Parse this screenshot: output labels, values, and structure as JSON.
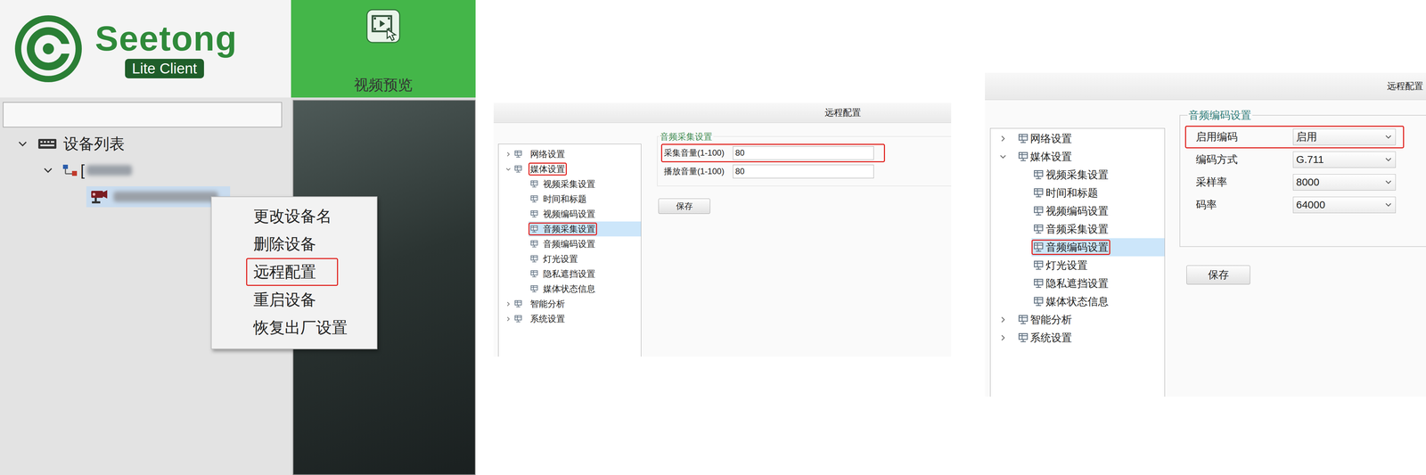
{
  "client": {
    "logo": {
      "name": "Seetong",
      "badge": "Lite Client"
    },
    "nav_tabs": [
      {
        "label": "视频预览",
        "selected": true
      }
    ],
    "device_tree": {
      "label": "设备列表",
      "expanded": true,
      "groups": [
        {
          "label": "[",
          "expanded": true,
          "devices": [
            {
              "selected": true
            }
          ]
        }
      ]
    },
    "context_menu": [
      {
        "label": "更改设备名",
        "highlighted": false
      },
      {
        "label": "删除设备",
        "highlighted": false
      },
      {
        "label": "远程配置",
        "highlighted": true
      },
      {
        "label": "重启设备",
        "highlighted": false
      },
      {
        "label": "恢复出厂设置",
        "highlighted": false
      }
    ]
  },
  "windows": [
    {
      "title": "远程配置",
      "tree": [
        {
          "label": "网络设置",
          "expanded": false,
          "highlighted": false,
          "selected": false,
          "children": []
        },
        {
          "label": "媒体设置",
          "expanded": true,
          "highlighted": true,
          "selected": false,
          "children": [
            {
              "label": "视频采集设置",
              "highlighted": false,
              "selected": false
            },
            {
              "label": "时间和标题",
              "highlighted": false,
              "selected": false
            },
            {
              "label": "视频编码设置",
              "highlighted": false,
              "selected": false
            },
            {
              "label": "音频采集设置",
              "highlighted": true,
              "selected": true
            },
            {
              "label": "音频编码设置",
              "highlighted": false,
              "selected": false
            },
            {
              "label": "灯光设置",
              "highlighted": false,
              "selected": false
            },
            {
              "label": "隐私遮挡设置",
              "highlighted": false,
              "selected": false
            },
            {
              "label": "媒体状态信息",
              "highlighted": false,
              "selected": false
            }
          ]
        },
        {
          "label": "智能分析",
          "expanded": false,
          "highlighted": false,
          "selected": false,
          "children": []
        },
        {
          "label": "系统设置",
          "expanded": false,
          "highlighted": false,
          "selected": false,
          "children": []
        }
      ],
      "section": {
        "title": "音频采集设置",
        "fields": [
          {
            "label": "采集音量(1-100)",
            "value": "80",
            "kind": "input",
            "highlighted": true
          },
          {
            "label": "播放音量(1-100)",
            "value": "80",
            "kind": "input",
            "highlighted": false
          }
        ]
      },
      "save": "保存"
    },
    {
      "title": "远程配置",
      "tree": [
        {
          "label": "网络设置",
          "expanded": false,
          "highlighted": false,
          "selected": false,
          "children": []
        },
        {
          "label": "媒体设置",
          "expanded": true,
          "highlighted": false,
          "selected": false,
          "children": [
            {
              "label": "视频采集设置",
              "highlighted": false,
              "selected": false
            },
            {
              "label": "时间和标题",
              "highlighted": false,
              "selected": false
            },
            {
              "label": "视频编码设置",
              "highlighted": false,
              "selected": false
            },
            {
              "label": "音频采集设置",
              "highlighted": false,
              "selected": false
            },
            {
              "label": "音频编码设置",
              "highlighted": true,
              "selected": true
            },
            {
              "label": "灯光设置",
              "highlighted": false,
              "selected": false
            },
            {
              "label": "隐私遮挡设置",
              "highlighted": false,
              "selected": false
            },
            {
              "label": "媒体状态信息",
              "highlighted": false,
              "selected": false
            }
          ]
        },
        {
          "label": "智能分析",
          "expanded": false,
          "highlighted": false,
          "selected": false,
          "children": []
        },
        {
          "label": "系统设置",
          "expanded": false,
          "highlighted": false,
          "selected": false,
          "children": []
        }
      ],
      "section": {
        "title": "音频编码设置",
        "fields": [
          {
            "label": "启用编码",
            "value": "启用",
            "kind": "select",
            "highlighted": true
          },
          {
            "label": "编码方式",
            "value": "G.711",
            "kind": "select",
            "highlighted": false
          },
          {
            "label": "采样率",
            "value": "8000",
            "kind": "select",
            "highlighted": false
          },
          {
            "label": "码率",
            "value": "64000",
            "kind": "select",
            "highlighted": false
          }
        ]
      },
      "save": "保存"
    }
  ]
}
